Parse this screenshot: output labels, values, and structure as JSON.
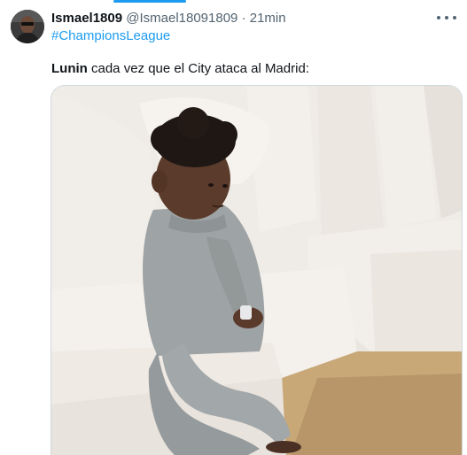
{
  "tweet": {
    "display_name": "Ismael1809",
    "handle": "@Ismael18091809",
    "separator": "·",
    "time": "21min",
    "hashtag": "#ChampionsLeague",
    "text_bold": "Lunin",
    "text_rest": " cada vez que el City ataca al Madrid:"
  },
  "icons": {
    "more": "more-dots-icon",
    "avatar": "avatar"
  },
  "colors": {
    "link": "#1d9bf0",
    "secondary_text": "#536471",
    "primary_text": "#0f1419",
    "border": "#cfd9de"
  }
}
